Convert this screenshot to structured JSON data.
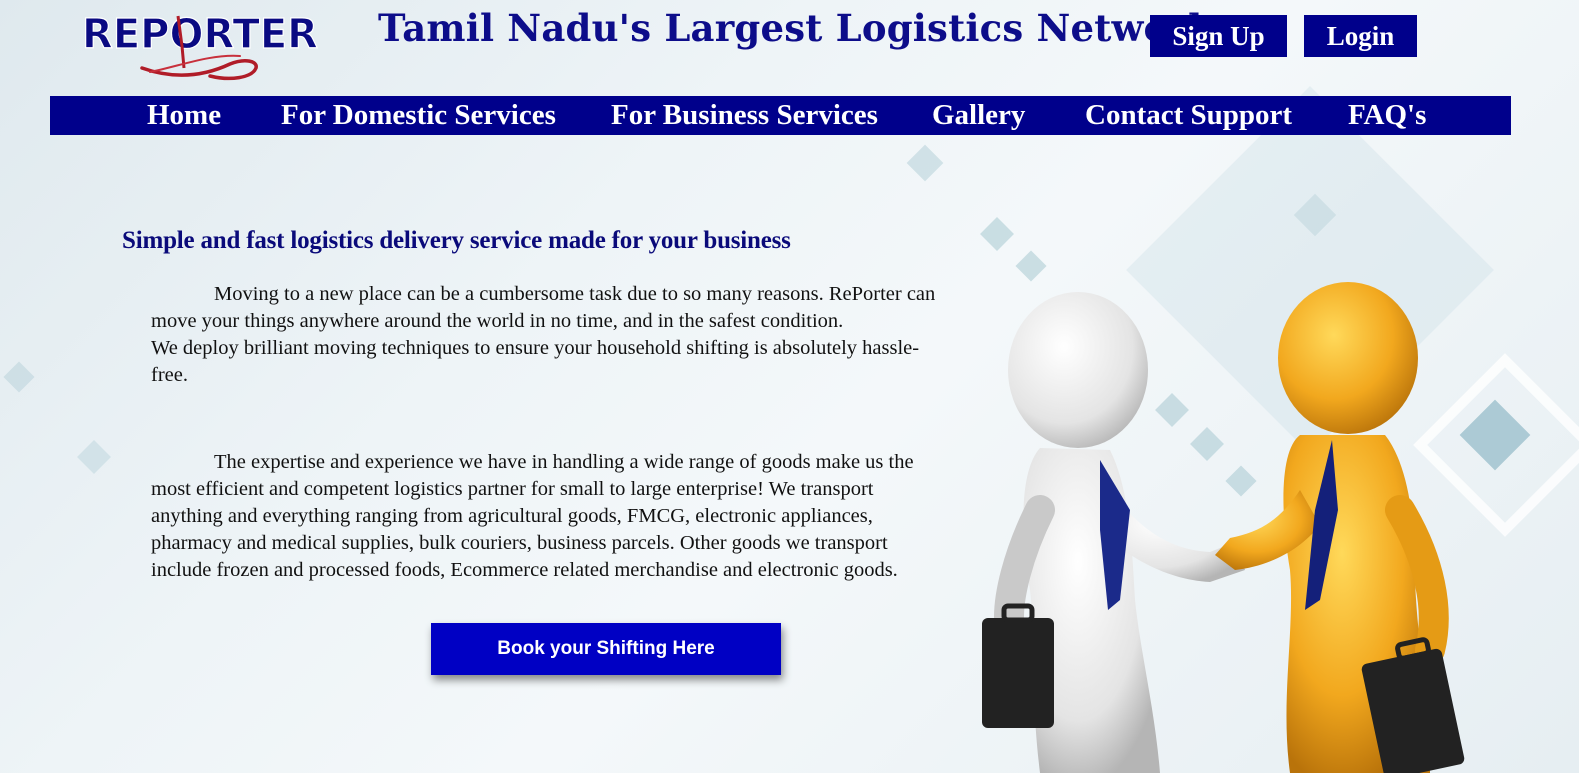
{
  "header": {
    "logo_text": "REPORTER",
    "site_title": "Tamil Nadu's Largest Logistics Network",
    "signup_label": "Sign Up",
    "login_label": "Login"
  },
  "nav": {
    "items": [
      {
        "label": "Home"
      },
      {
        "label": "For Domestic Services"
      },
      {
        "label": "For Business Services"
      },
      {
        "label": "Gallery"
      },
      {
        "label": "Contact Support"
      },
      {
        "label": "FAQ's"
      }
    ]
  },
  "main": {
    "heading": "Simple and fast logistics delivery service made for your business",
    "para1": {
      "line1": "Moving to a new place can be a cumbersome task due to so many reasons. RePorter can",
      "line2": "move your things anywhere around the world in no time, and in the safest condition.",
      "line3": "We deploy brilliant moving techniques to ensure your household shifting is absolutely hassle-",
      "line4": "free."
    },
    "para2": {
      "line1": "The expertise and experience we have in handling a wide range of goods make us the",
      "line2": "most efficient and competent logistics partner for small to large enterprise! We transport",
      "line3": "anything and everything ranging from agricultural goods, FMCG, electronic appliances,",
      "line4": "pharmacy and medical supplies, bulk couriers, business parcels. Other goods we transport",
      "line5": "include frozen and processed foods, Ecommerce related merchandise and electronic goods."
    },
    "cta_label": "Book your Shifting Here"
  },
  "colors": {
    "primary_navy": "#00008b",
    "cta_blue": "#0000c4",
    "title_navy": "#0d0d8a",
    "logo_red": "#b01c28"
  },
  "icons": {
    "illustration": "handshake-figures-illustration"
  }
}
